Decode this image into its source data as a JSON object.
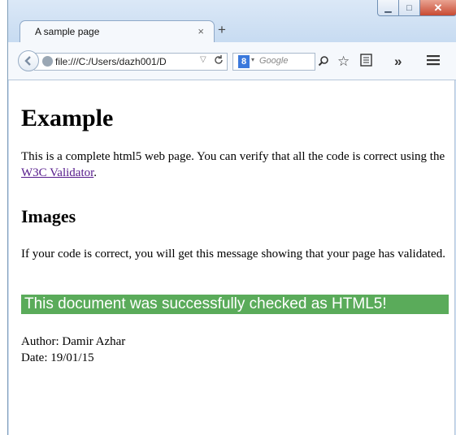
{
  "browser": {
    "tab_title": "A sample page",
    "tab_close": "×",
    "new_tab": "+",
    "url": "file:///C:/Users/dazh001/D",
    "url_dropdown": "▽",
    "reload": "C",
    "search_engine": "8",
    "search_dropdown": "▾",
    "search_placeholder": "Google",
    "minimize": "▁",
    "maximize": "□",
    "close": "✕"
  },
  "page": {
    "heading": "Example",
    "intro_before_link": "This is a complete html5 web page. You can verify that all the code is correct using the ",
    "intro_link": "W3C Validator",
    "intro_after_link": ".",
    "subheading": "Images",
    "images_text": "If your code is correct, you will get this message showing that your page has validated.",
    "validation_banner": "This document was successfully checked as HTML5!",
    "author": "Author: Damir Azhar",
    "date": "Date: 19/01/15"
  },
  "colors": {
    "banner_bg": "#5aab5a",
    "link": "#551a8b",
    "close_button": "#c84a32"
  },
  "icons": [
    "back-arrow-icon",
    "globe-icon",
    "reload-icon",
    "google-icon",
    "search-icon",
    "bookmark-star-icon",
    "reading-list-icon",
    "overflow-icon",
    "menu-icon"
  ]
}
